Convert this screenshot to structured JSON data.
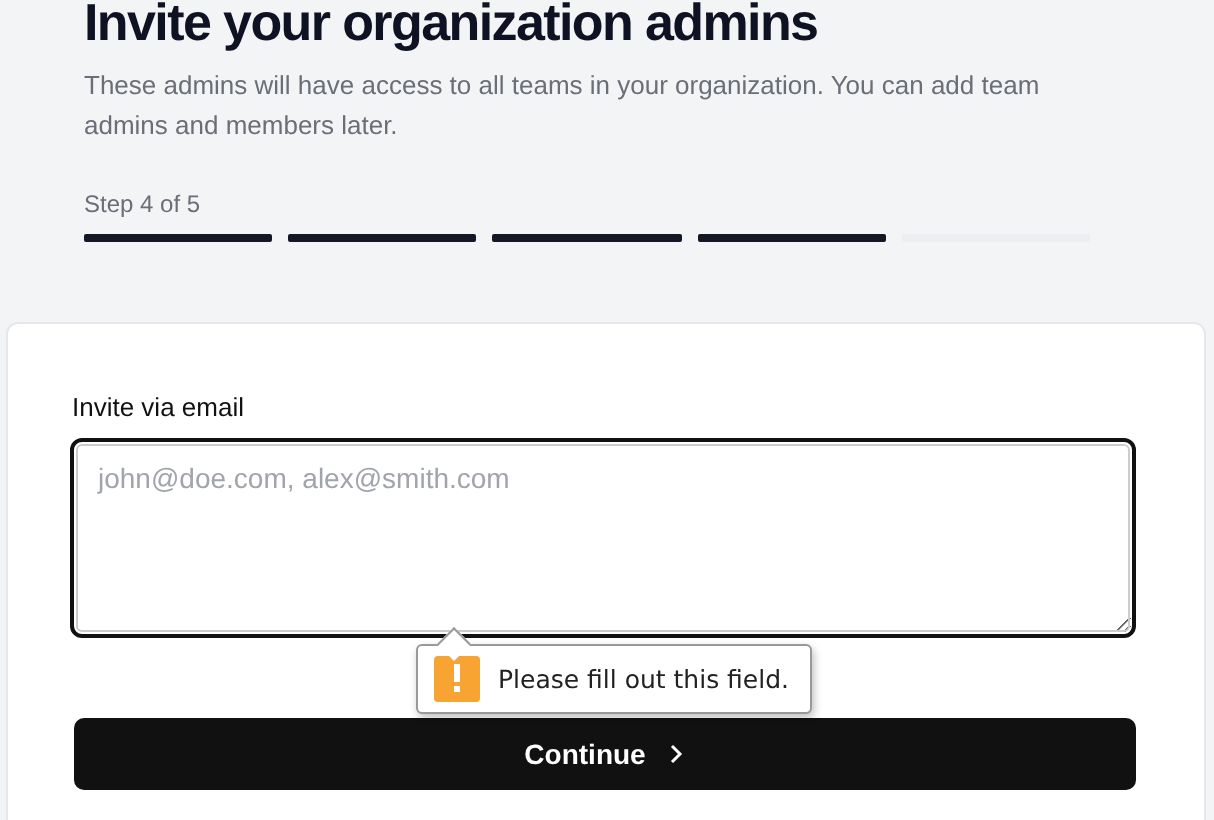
{
  "header": {
    "title": "Invite your organization admins",
    "description": "These admins will have access to all teams in your organization. You can add team admins and members later.",
    "step_label": "Step 4 of 5",
    "steps": [
      {
        "completed": true
      },
      {
        "completed": true
      },
      {
        "completed": true
      },
      {
        "completed": true
      },
      {
        "completed": false
      }
    ]
  },
  "form": {
    "field_label": "Invite via email",
    "placeholder": "john@doe.com, alex@smith.com",
    "validation_message": "Please fill out this field.",
    "button": "Continue"
  }
}
